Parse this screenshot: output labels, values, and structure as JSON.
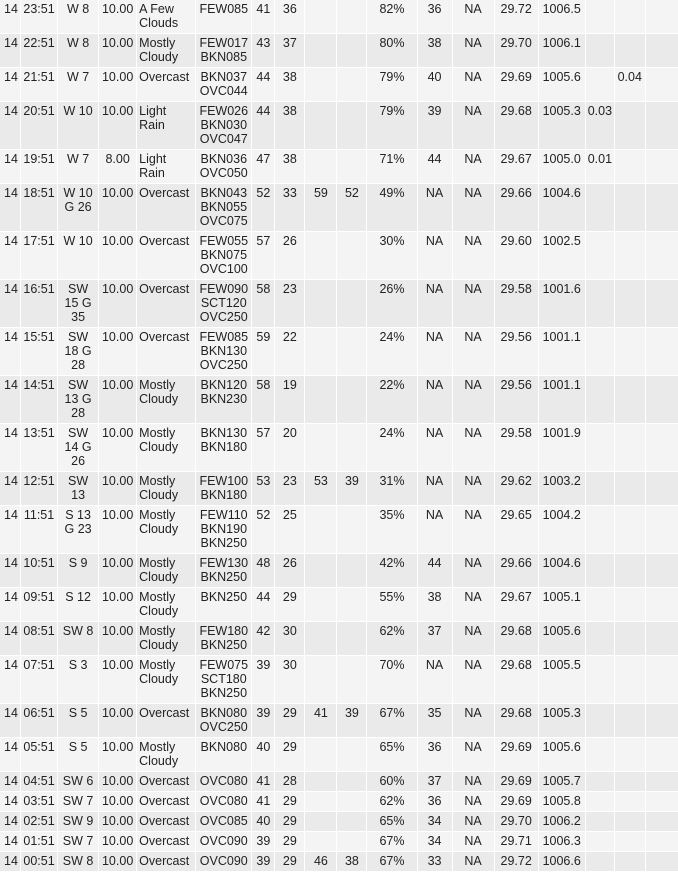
{
  "table": {
    "rows": [
      [
        "14",
        "23:51",
        "W 8",
        "10.00",
        "A Few\nClouds",
        "FEW085",
        "41",
        "36",
        "",
        "",
        "82%",
        "36",
        "NA",
        "29.72",
        "1006.5",
        "",
        "",
        ""
      ],
      [
        "14",
        "22:51",
        "W 8",
        "10.00",
        "Mostly\nCloudy",
        "FEW017\nBKN085",
        "43",
        "37",
        "",
        "",
        "80%",
        "38",
        "NA",
        "29.70",
        "1006.1",
        "",
        "",
        ""
      ],
      [
        "14",
        "21:51",
        "W 7",
        "10.00",
        "Overcast",
        "BKN037\nOVC044",
        "44",
        "38",
        "",
        "",
        "79%",
        "40",
        "NA",
        "29.69",
        "1005.6",
        "",
        "0.04",
        ""
      ],
      [
        "14",
        "20:51",
        "W 10",
        "10.00",
        "Light\nRain",
        "FEW026\nBKN030\nOVC047",
        "44",
        "38",
        "",
        "",
        "79%",
        "39",
        "NA",
        "29.68",
        "1005.3",
        "0.03",
        "",
        ""
      ],
      [
        "14",
        "19:51",
        "W 7",
        "8.00",
        "Light\nRain",
        "BKN036\nOVC050",
        "47",
        "38",
        "",
        "",
        "71%",
        "44",
        "NA",
        "29.67",
        "1005.0",
        "0.01",
        "",
        ""
      ],
      [
        "14",
        "18:51",
        "W 10\nG 26",
        "10.00",
        "Overcast",
        "BKN043\nBKN055\nOVC075",
        "52",
        "33",
        "59",
        "52",
        "49%",
        "NA",
        "NA",
        "29.66",
        "1004.6",
        "",
        "",
        ""
      ],
      [
        "14",
        "17:51",
        "W 10",
        "10.00",
        "Overcast",
        "FEW055\nBKN075\nOVC100",
        "57",
        "26",
        "",
        "",
        "30%",
        "NA",
        "NA",
        "29.60",
        "1002.5",
        "",
        "",
        ""
      ],
      [
        "14",
        "16:51",
        "SW\n15 G\n35",
        "10.00",
        "Overcast",
        "FEW090\nSCT120\nOVC250",
        "58",
        "23",
        "",
        "",
        "26%",
        "NA",
        "NA",
        "29.58",
        "1001.6",
        "",
        "",
        ""
      ],
      [
        "14",
        "15:51",
        "SW\n18 G\n28",
        "10.00",
        "Overcast",
        "FEW085\nBKN130\nOVC250",
        "59",
        "22",
        "",
        "",
        "24%",
        "NA",
        "NA",
        "29.56",
        "1001.1",
        "",
        "",
        ""
      ],
      [
        "14",
        "14:51",
        "SW\n13 G\n28",
        "10.00",
        "Mostly\nCloudy",
        "BKN120\nBKN230",
        "58",
        "19",
        "",
        "",
        "22%",
        "NA",
        "NA",
        "29.56",
        "1001.1",
        "",
        "",
        ""
      ],
      [
        "14",
        "13:51",
        "SW\n14 G\n26",
        "10.00",
        "Mostly\nCloudy",
        "BKN130\nBKN180",
        "57",
        "20",
        "",
        "",
        "24%",
        "NA",
        "NA",
        "29.58",
        "1001.9",
        "",
        "",
        ""
      ],
      [
        "14",
        "12:51",
        "SW\n13",
        "10.00",
        "Mostly\nCloudy",
        "FEW100\nBKN180",
        "53",
        "23",
        "53",
        "39",
        "31%",
        "NA",
        "NA",
        "29.62",
        "1003.2",
        "",
        "",
        ""
      ],
      [
        "14",
        "11:51",
        "S 13\nG 23",
        "10.00",
        "Mostly\nCloudy",
        "FEW110\nBKN190\nBKN250",
        "52",
        "25",
        "",
        "",
        "35%",
        "NA",
        "NA",
        "29.65",
        "1004.2",
        "",
        "",
        ""
      ],
      [
        "14",
        "10:51",
        "S 9",
        "10.00",
        "Mostly\nCloudy",
        "FEW130\nBKN250",
        "48",
        "26",
        "",
        "",
        "42%",
        "44",
        "NA",
        "29.66",
        "1004.6",
        "",
        "",
        ""
      ],
      [
        "14",
        "09:51",
        "S 12",
        "10.00",
        "Mostly\nCloudy",
        "BKN250",
        "44",
        "29",
        "",
        "",
        "55%",
        "38",
        "NA",
        "29.67",
        "1005.1",
        "",
        "",
        ""
      ],
      [
        "14",
        "08:51",
        "SW 8",
        "10.00",
        "Mostly\nCloudy",
        "FEW180\nBKN250",
        "42",
        "30",
        "",
        "",
        "62%",
        "37",
        "NA",
        "29.68",
        "1005.6",
        "",
        "",
        ""
      ],
      [
        "14",
        "07:51",
        "S 3",
        "10.00",
        "Mostly\nCloudy",
        "FEW075\nSCT180\nBKN250",
        "39",
        "30",
        "",
        "",
        "70%",
        "NA",
        "NA",
        "29.68",
        "1005.5",
        "",
        "",
        ""
      ],
      [
        "14",
        "06:51",
        "S 5",
        "10.00",
        "Overcast",
        "BKN080\nOVC250",
        "39",
        "29",
        "41",
        "39",
        "67%",
        "35",
        "NA",
        "29.68",
        "1005.3",
        "",
        "",
        ""
      ],
      [
        "14",
        "05:51",
        "S 5",
        "10.00",
        "Mostly\nCloudy",
        "BKN080",
        "40",
        "29",
        "",
        "",
        "65%",
        "36",
        "NA",
        "29.69",
        "1005.6",
        "",
        "",
        ""
      ],
      [
        "14",
        "04:51",
        "SW 6",
        "10.00",
        "Overcast",
        "OVC080",
        "41",
        "28",
        "",
        "",
        "60%",
        "37",
        "NA",
        "29.69",
        "1005.7",
        "",
        "",
        ""
      ],
      [
        "14",
        "03:51",
        "SW 7",
        "10.00",
        "Overcast",
        "OVC080",
        "41",
        "29",
        "",
        "",
        "62%",
        "36",
        "NA",
        "29.69",
        "1005.8",
        "",
        "",
        ""
      ],
      [
        "14",
        "02:51",
        "SW 9",
        "10.00",
        "Overcast",
        "OVC085",
        "40",
        "29",
        "",
        "",
        "65%",
        "34",
        "NA",
        "29.70",
        "1006.2",
        "",
        "",
        ""
      ],
      [
        "14",
        "01:51",
        "SW 7",
        "10.00",
        "Overcast",
        "OVC090",
        "39",
        "29",
        "",
        "",
        "67%",
        "34",
        "NA",
        "29.71",
        "1006.3",
        "",
        "",
        ""
      ],
      [
        "14",
        "00:51",
        "SW 8",
        "10.00",
        "Overcast",
        "OVC090",
        "39",
        "29",
        "46",
        "38",
        "67%",
        "33",
        "NA",
        "29.72",
        "1006.6",
        "",
        "",
        ""
      ]
    ]
  }
}
